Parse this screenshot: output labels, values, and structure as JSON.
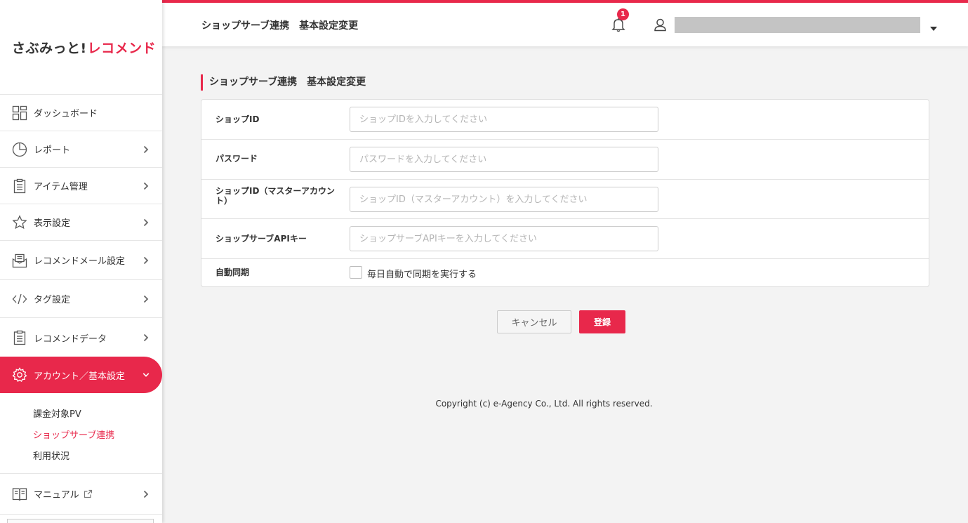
{
  "brand": {
    "logo_part1": "さぶみっと!",
    "logo_part2": "レコメンド",
    "accent": "#e8284b"
  },
  "sidebar": {
    "items": [
      {
        "label": "ダッシュボード",
        "icon": "dashboard-icon",
        "has_chevron": false
      },
      {
        "label": "レポート",
        "icon": "pie-chart-icon",
        "has_chevron": true
      },
      {
        "label": "アイテム管理",
        "icon": "clipboard-icon",
        "has_chevron": true
      },
      {
        "label": "表示設定",
        "icon": "star-icon",
        "has_chevron": true
      },
      {
        "label": "レコメンドメール設定",
        "icon": "mail-icon",
        "has_chevron": true
      },
      {
        "label": "タグ設定",
        "icon": "code-icon",
        "has_chevron": true
      },
      {
        "label": "レコメンドデータ",
        "icon": "clipboard-icon",
        "has_chevron": true
      },
      {
        "label": "アカウント／基本設定",
        "icon": "gear-icon",
        "has_chevron": true,
        "active": true
      },
      {
        "label": "マニュアル",
        "icon": "book-icon",
        "has_chevron": true,
        "external": true
      }
    ],
    "submenu": [
      {
        "label": "課金対象PV"
      },
      {
        "label": "ショップサーブ連携",
        "current": true
      },
      {
        "label": "利用状況"
      }
    ]
  },
  "header": {
    "title": "ショップサーブ連携　基本設定変更",
    "notification_count": "1"
  },
  "main": {
    "section_title": "ショップサーブ連携　基本設定変更",
    "form": {
      "shop_id": {
        "label": "ショップID",
        "placeholder": "ショップIDを入力してください",
        "value": ""
      },
      "password": {
        "label": "パスワード",
        "placeholder": "パスワードを入力してください",
        "value": ""
      },
      "master_id": {
        "label": "ショップID（マスターアカウント）",
        "placeholder": "ショップID（マスターアカウント）を入力してください",
        "value": ""
      },
      "api_key": {
        "label": "ショップサーブAPIキー",
        "placeholder": "ショップサーブAPIキーを入力してください",
        "value": ""
      },
      "auto_sync": {
        "label": "自動同期",
        "checkbox_label": "毎日自動で同期を実行する",
        "checked": false
      }
    },
    "buttons": {
      "cancel": "キャンセル",
      "submit": "登録"
    }
  },
  "footer": {
    "copyright": "Copyright (c) e-Agency Co., Ltd. All rights reserved."
  }
}
